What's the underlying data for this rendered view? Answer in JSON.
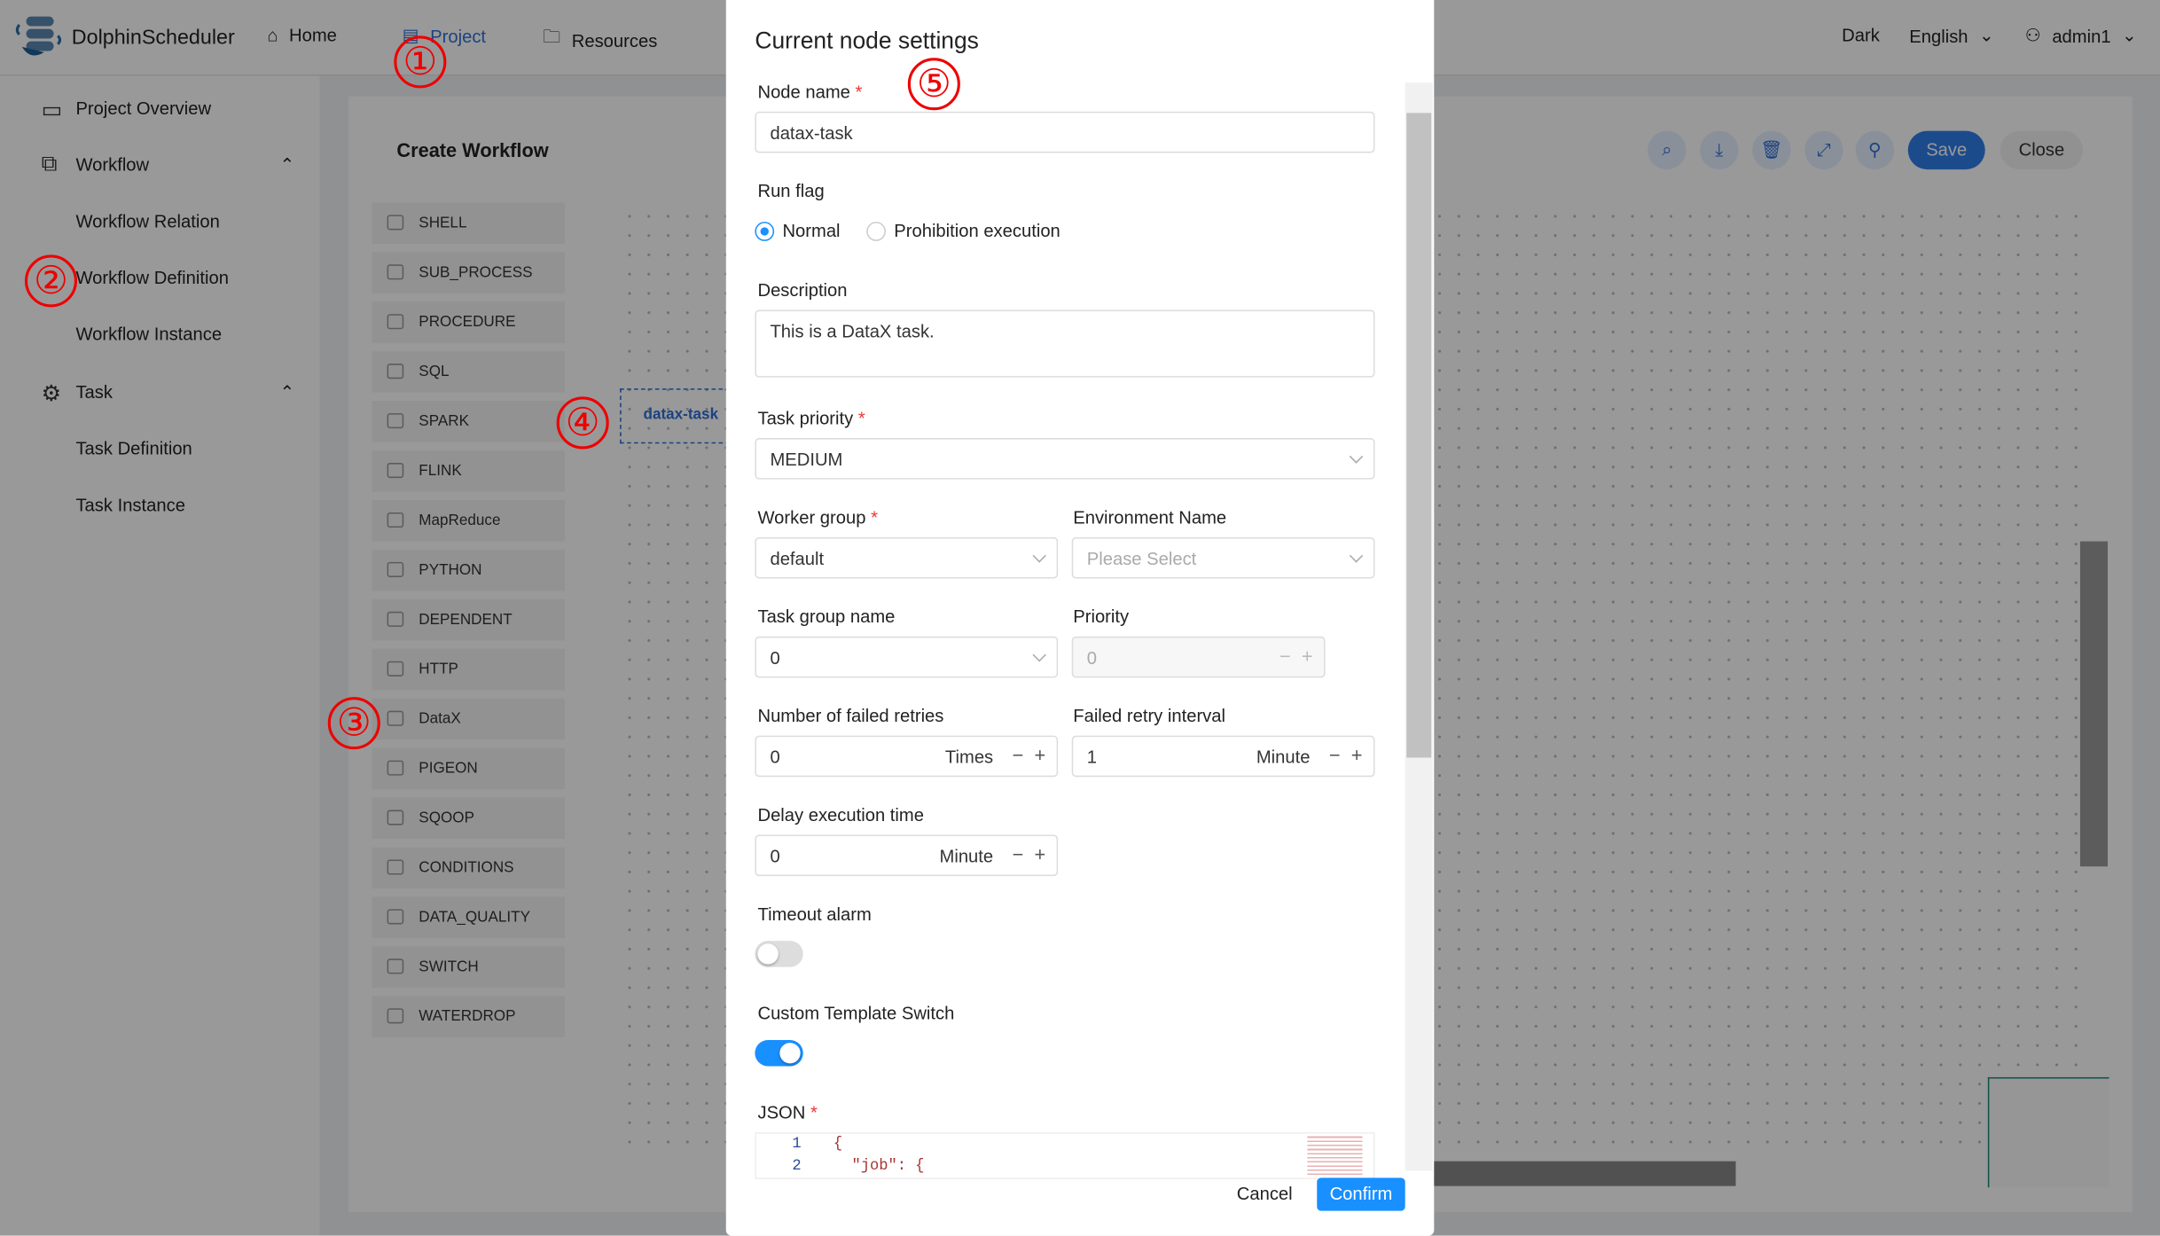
{
  "header": {
    "brand": "DolphinScheduler",
    "nav": [
      "Home",
      "Project",
      "Resources"
    ],
    "theme": "Dark",
    "language": "English",
    "user": "admin1"
  },
  "sidebar": {
    "items": [
      "Project Overview",
      "Workflow",
      "Workflow Relation",
      "Workflow Definition",
      "Workflow Instance",
      "Task",
      "Task Definition",
      "Task Instance"
    ]
  },
  "annotations": [
    "①",
    "②",
    "③",
    "④",
    "⑤"
  ],
  "editor": {
    "title": "Create Workflow",
    "save": "Save",
    "close": "Close",
    "node_label": "datax-task",
    "palette": [
      "SHELL",
      "SUB_PROCESS",
      "PROCEDURE",
      "SQL",
      "SPARK",
      "FLINK",
      "MapReduce",
      "PYTHON",
      "DEPENDENT",
      "HTTP",
      "DataX",
      "PIGEON",
      "SQOOP",
      "CONDITIONS",
      "DATA_QUALITY",
      "SWITCH",
      "WATERDROP"
    ]
  },
  "modal": {
    "title": "Current node settings",
    "node_name_label": "Node name",
    "node_name": "datax-task",
    "run_flag_label": "Run flag",
    "run_normal": "Normal",
    "run_prohibit": "Prohibition execution",
    "description_label": "Description",
    "description": "This is a DataX task.",
    "task_priority_label": "Task priority",
    "task_priority": "MEDIUM",
    "worker_group_label": "Worker group",
    "worker_group": "default",
    "env_label": "Environment Name",
    "env_placeholder": "Please Select",
    "task_group_label": "Task group name",
    "task_group": "0",
    "priority_label": "Priority",
    "priority": "0",
    "retries_label": "Number of failed retries",
    "retries": "0",
    "retries_unit": "Times",
    "retry_interval_label": "Failed retry interval",
    "retry_interval": "1",
    "retry_interval_unit": "Minute",
    "delay_label": "Delay execution time",
    "delay": "0",
    "delay_unit": "Minute",
    "timeout_label": "Timeout alarm",
    "custom_template_label": "Custom Template Switch",
    "json_label": "JSON",
    "json_lines": [
      {
        "n": "1",
        "code": "{"
      },
      {
        "n": "2",
        "code": "  \"job\": {"
      }
    ],
    "cancel": "Cancel",
    "confirm": "Confirm",
    "minus": "−",
    "plus": "+"
  }
}
